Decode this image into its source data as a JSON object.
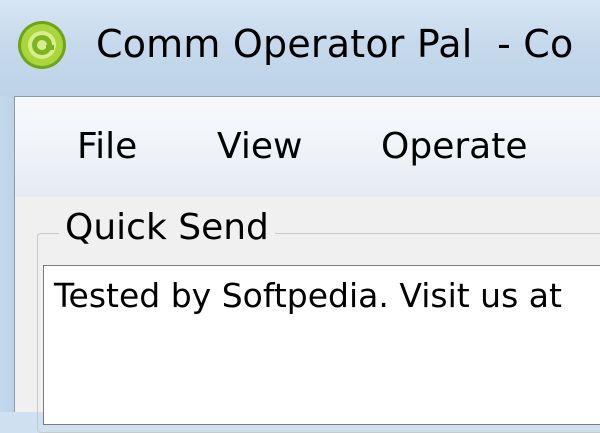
{
  "window": {
    "title": "Comm Operator Pal  - Co",
    "icon": "comm-operator-pal-app-icon"
  },
  "menu": {
    "items": [
      {
        "label": "File"
      },
      {
        "label": "View"
      },
      {
        "label": "Operate"
      }
    ]
  },
  "quick_send": {
    "group_label": "Quick Send",
    "text": "Tested by Softpedia. Visit us at"
  },
  "colors": {
    "icon_green": "#9acd32",
    "icon_dark_green": "#5a8f00",
    "titlebar": "#c6d9ec",
    "client_background": "#f0f0f0"
  }
}
